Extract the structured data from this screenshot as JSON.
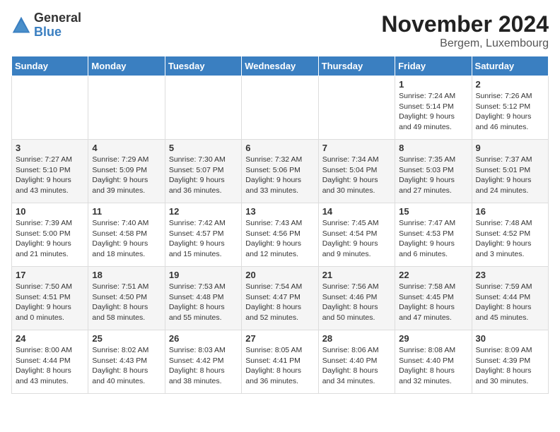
{
  "header": {
    "logo_general": "General",
    "logo_blue": "Blue",
    "month_title": "November 2024",
    "location": "Bergem, Luxembourg"
  },
  "days_of_week": [
    "Sunday",
    "Monday",
    "Tuesday",
    "Wednesday",
    "Thursday",
    "Friday",
    "Saturday"
  ],
  "weeks": [
    [
      {
        "day": "",
        "info": ""
      },
      {
        "day": "",
        "info": ""
      },
      {
        "day": "",
        "info": ""
      },
      {
        "day": "",
        "info": ""
      },
      {
        "day": "",
        "info": ""
      },
      {
        "day": "1",
        "info": "Sunrise: 7:24 AM\nSunset: 5:14 PM\nDaylight: 9 hours and 49 minutes."
      },
      {
        "day": "2",
        "info": "Sunrise: 7:26 AM\nSunset: 5:12 PM\nDaylight: 9 hours and 46 minutes."
      }
    ],
    [
      {
        "day": "3",
        "info": "Sunrise: 7:27 AM\nSunset: 5:10 PM\nDaylight: 9 hours and 43 minutes."
      },
      {
        "day": "4",
        "info": "Sunrise: 7:29 AM\nSunset: 5:09 PM\nDaylight: 9 hours and 39 minutes."
      },
      {
        "day": "5",
        "info": "Sunrise: 7:30 AM\nSunset: 5:07 PM\nDaylight: 9 hours and 36 minutes."
      },
      {
        "day": "6",
        "info": "Sunrise: 7:32 AM\nSunset: 5:06 PM\nDaylight: 9 hours and 33 minutes."
      },
      {
        "day": "7",
        "info": "Sunrise: 7:34 AM\nSunset: 5:04 PM\nDaylight: 9 hours and 30 minutes."
      },
      {
        "day": "8",
        "info": "Sunrise: 7:35 AM\nSunset: 5:03 PM\nDaylight: 9 hours and 27 minutes."
      },
      {
        "day": "9",
        "info": "Sunrise: 7:37 AM\nSunset: 5:01 PM\nDaylight: 9 hours and 24 minutes."
      }
    ],
    [
      {
        "day": "10",
        "info": "Sunrise: 7:39 AM\nSunset: 5:00 PM\nDaylight: 9 hours and 21 minutes."
      },
      {
        "day": "11",
        "info": "Sunrise: 7:40 AM\nSunset: 4:58 PM\nDaylight: 9 hours and 18 minutes."
      },
      {
        "day": "12",
        "info": "Sunrise: 7:42 AM\nSunset: 4:57 PM\nDaylight: 9 hours and 15 minutes."
      },
      {
        "day": "13",
        "info": "Sunrise: 7:43 AM\nSunset: 4:56 PM\nDaylight: 9 hours and 12 minutes."
      },
      {
        "day": "14",
        "info": "Sunrise: 7:45 AM\nSunset: 4:54 PM\nDaylight: 9 hours and 9 minutes."
      },
      {
        "day": "15",
        "info": "Sunrise: 7:47 AM\nSunset: 4:53 PM\nDaylight: 9 hours and 6 minutes."
      },
      {
        "day": "16",
        "info": "Sunrise: 7:48 AM\nSunset: 4:52 PM\nDaylight: 9 hours and 3 minutes."
      }
    ],
    [
      {
        "day": "17",
        "info": "Sunrise: 7:50 AM\nSunset: 4:51 PM\nDaylight: 9 hours and 0 minutes."
      },
      {
        "day": "18",
        "info": "Sunrise: 7:51 AM\nSunset: 4:50 PM\nDaylight: 8 hours and 58 minutes."
      },
      {
        "day": "19",
        "info": "Sunrise: 7:53 AM\nSunset: 4:48 PM\nDaylight: 8 hours and 55 minutes."
      },
      {
        "day": "20",
        "info": "Sunrise: 7:54 AM\nSunset: 4:47 PM\nDaylight: 8 hours and 52 minutes."
      },
      {
        "day": "21",
        "info": "Sunrise: 7:56 AM\nSunset: 4:46 PM\nDaylight: 8 hours and 50 minutes."
      },
      {
        "day": "22",
        "info": "Sunrise: 7:58 AM\nSunset: 4:45 PM\nDaylight: 8 hours and 47 minutes."
      },
      {
        "day": "23",
        "info": "Sunrise: 7:59 AM\nSunset: 4:44 PM\nDaylight: 8 hours and 45 minutes."
      }
    ],
    [
      {
        "day": "24",
        "info": "Sunrise: 8:00 AM\nSunset: 4:44 PM\nDaylight: 8 hours and 43 minutes."
      },
      {
        "day": "25",
        "info": "Sunrise: 8:02 AM\nSunset: 4:43 PM\nDaylight: 8 hours and 40 minutes."
      },
      {
        "day": "26",
        "info": "Sunrise: 8:03 AM\nSunset: 4:42 PM\nDaylight: 8 hours and 38 minutes."
      },
      {
        "day": "27",
        "info": "Sunrise: 8:05 AM\nSunset: 4:41 PM\nDaylight: 8 hours and 36 minutes."
      },
      {
        "day": "28",
        "info": "Sunrise: 8:06 AM\nSunset: 4:40 PM\nDaylight: 8 hours and 34 minutes."
      },
      {
        "day": "29",
        "info": "Sunrise: 8:08 AM\nSunset: 4:40 PM\nDaylight: 8 hours and 32 minutes."
      },
      {
        "day": "30",
        "info": "Sunrise: 8:09 AM\nSunset: 4:39 PM\nDaylight: 8 hours and 30 minutes."
      }
    ]
  ]
}
